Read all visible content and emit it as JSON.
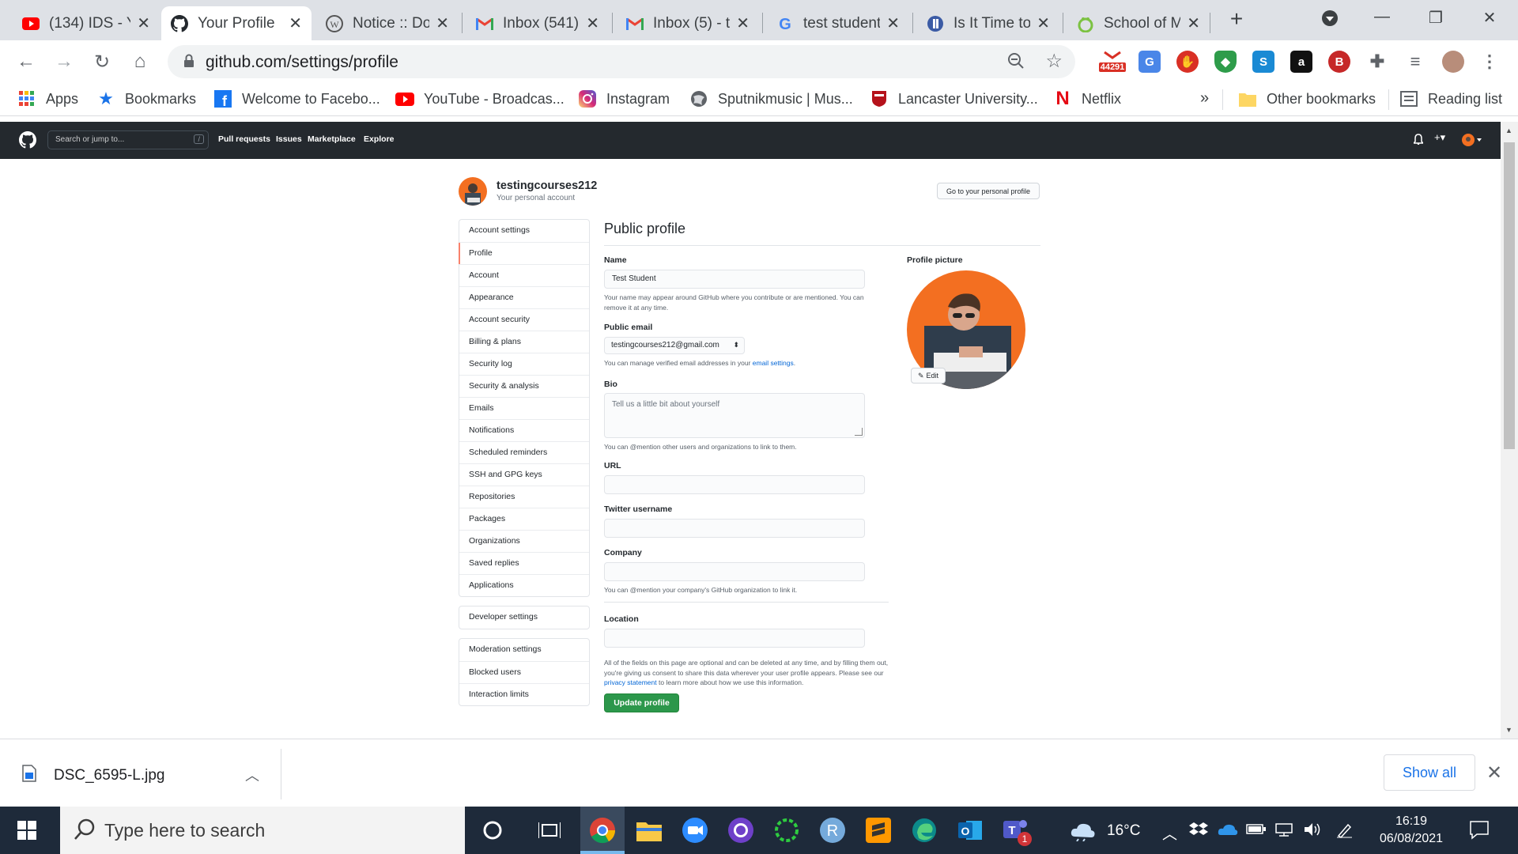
{
  "browser": {
    "tabs": [
      {
        "title": "(134) IDS - Y",
        "icon": "youtube-icon",
        "active": false
      },
      {
        "title": "Your Profile",
        "icon": "github-icon",
        "active": true
      },
      {
        "title": "Notice :: Do",
        "icon": "wordpress-icon",
        "active": false
      },
      {
        "title": "Inbox (541)",
        "icon": "gmail-icon",
        "active": false
      },
      {
        "title": "Inbox (5) - t",
        "icon": "gmail-icon",
        "active": false
      },
      {
        "title": "test student",
        "icon": "google-icon",
        "active": false
      },
      {
        "title": "Is It Time to",
        "icon": "site-icon",
        "active": false
      },
      {
        "title": "School of M",
        "icon": "site-icon",
        "active": false
      }
    ],
    "url": "github.com/settings/profile",
    "extension_badge": "44291",
    "bookmarks": [
      {
        "label": "Apps",
        "icon": "apps-grid-icon"
      },
      {
        "label": "Bookmarks",
        "icon": "star-icon"
      },
      {
        "label": "Welcome to Facebo...",
        "icon": "facebook-icon"
      },
      {
        "label": "YouTube - Broadcas...",
        "icon": "youtube-icon"
      },
      {
        "label": "Instagram",
        "icon": "instagram-icon"
      },
      {
        "label": "Sputnikmusic | Mus...",
        "icon": "globe-icon"
      },
      {
        "label": "Lancaster University...",
        "icon": "crest-icon"
      },
      {
        "label": "Netflix",
        "icon": "netflix-icon"
      }
    ],
    "overflow_label": "»",
    "other_bookmarks": "Other bookmarks",
    "reading_list": "Reading list"
  },
  "github_header": {
    "search_placeholder": "Search or jump to...",
    "search_shortcut": "/",
    "nav": [
      "Pull requests",
      "Issues",
      "Marketplace",
      "Explore"
    ]
  },
  "account": {
    "username": "testingcourses212",
    "subtitle": "Your personal account",
    "personal_profile_button": "Go to your personal profile"
  },
  "sidebar": {
    "account_settings_heading": "Account settings",
    "items": [
      "Profile",
      "Account",
      "Appearance",
      "Account security",
      "Billing & plans",
      "Security log",
      "Security & analysis",
      "Emails",
      "Notifications",
      "Scheduled reminders",
      "SSH and GPG keys",
      "Repositories",
      "Packages",
      "Organizations",
      "Saved replies",
      "Applications"
    ],
    "selected": "Profile",
    "developer_settings": "Developer settings",
    "moderation_heading": "Moderation settings",
    "moderation_items": [
      "Blocked users",
      "Interaction limits"
    ]
  },
  "profile_form": {
    "title": "Public profile",
    "name_label": "Name",
    "name_value": "Test Student",
    "name_note": "Your name may appear around GitHub where you contribute or are mentioned. You can remove it at any time.",
    "email_label": "Public email",
    "email_value": "testingcourses212@gmail.com",
    "email_note_prefix": "You can manage verified email addresses in your",
    "email_note_link": "email settings",
    "bio_label": "Bio",
    "bio_placeholder": "Tell us a little bit about yourself",
    "bio_note": "You can @mention other users and organizations to link to them.",
    "url_label": "URL",
    "twitter_label": "Twitter username",
    "company_label": "Company",
    "company_note": "You can @mention your company's GitHub organization to link it.",
    "location_label": "Location",
    "privacy_note_1": "All of the fields on this page are optional and can be deleted at any time, and by filling them out, you're giving us consent to share this data wherever your user profile appears.",
    "privacy_note_2_prefix": "Please see our",
    "privacy_note_link": "privacy statement",
    "privacy_note_2_suffix": "to learn more about how we use this information.",
    "update_button": "Update profile",
    "picture_label": "Profile picture",
    "edit_button": "Edit"
  },
  "download_bar": {
    "file_name": "DSC_6595-L.jpg",
    "show_all": "Show all"
  },
  "taskbar": {
    "search_placeholder": "Type here to search",
    "weather": "16°C",
    "time": "16:19",
    "date": "06/08/2021",
    "teams_badge": "1"
  }
}
